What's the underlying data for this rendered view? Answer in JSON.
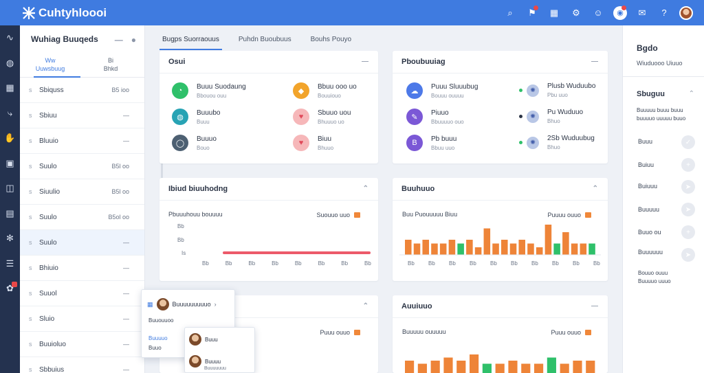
{
  "app": {
    "title": "Cuhtyhloooi"
  },
  "topbar": {
    "icons": [
      "search-icon",
      "alert-icon",
      "apps-icon",
      "settings-icon",
      "people-icon",
      "notifications-icon",
      "chat-icon",
      "help-icon",
      "user-avatar"
    ],
    "colors": {
      "bar": "#3f7be0",
      "badge": "#e94848"
    }
  },
  "rail": {
    "icons": [
      "activity-icon",
      "globe-icon",
      "grid-icon",
      "route-icon",
      "hand-icon",
      "window-icon",
      "box-icon",
      "layers-icon",
      "network-icon",
      "list-icon",
      "chat-alert-icon"
    ]
  },
  "panel2": {
    "title": "Wuhiag Buuqeds",
    "tabs": [
      {
        "top": "Ww",
        "label": "Uuwsbuug",
        "active": true
      },
      {
        "top": "Bi",
        "label": "Bhkd",
        "active": false
      }
    ],
    "rows": [
      {
        "num": "s",
        "label": "Sbiquss",
        "meta": "B5 ioo"
      },
      {
        "num": "s",
        "label": "Sbiuu",
        "meta": "—"
      },
      {
        "num": "s",
        "label": "Bluuio",
        "meta": "—"
      },
      {
        "num": "s",
        "label": "Suulo",
        "meta": "B5l oo"
      },
      {
        "num": "s",
        "label": "Siuulio",
        "meta": "B5l oo"
      },
      {
        "num": "s",
        "label": "Suulo",
        "meta": "B5ol oo"
      },
      {
        "num": "s",
        "label": "Suulo",
        "meta": "—"
      },
      {
        "num": "s",
        "label": "Bhiuio",
        "meta": "—"
      },
      {
        "num": "s",
        "label": "Suuol",
        "meta": "—"
      },
      {
        "num": "s",
        "label": "Sluio",
        "meta": "—"
      },
      {
        "num": "s",
        "label": "Buuioluo",
        "meta": "—"
      },
      {
        "num": "s",
        "label": "Sbbuius",
        "meta": "—"
      }
    ]
  },
  "main": {
    "tabs": [
      {
        "label": "Bugps Suorraouus",
        "active": true
      },
      {
        "label": "Puhdn Buoubuus",
        "active": false
      },
      {
        "label": "Bouhs Pouyo",
        "active": false
      }
    ],
    "card1": {
      "title": "Osui",
      "services": [
        {
          "title": "Buuu Suodaung",
          "sub": "Bbouou ouu",
          "color": "#2fc06a",
          "icon": "cloud-icon"
        },
        {
          "title": "Bbuu ooo uo",
          "sub": "Bouuiouo",
          "color": "#f2a42b",
          "icon": "server-icon"
        },
        {
          "title": "Buuubo",
          "sub": "Buuu",
          "color": "#27a3b4",
          "icon": "globe-icon"
        },
        {
          "title": "Sbuuo uou",
          "sub": "Bhuuuo uo",
          "color": "#f6b7b9",
          "icon": "heart-icon"
        },
        {
          "title": "Buuuo",
          "sub": "Bouo",
          "color": "#4d6072",
          "icon": "ring-icon"
        },
        {
          "title": "Biuu",
          "sub": "Bhuuo",
          "color": "#f6b7b9",
          "icon": "heart-icon"
        }
      ]
    },
    "card2": {
      "title": "Pboubuuiag",
      "services": [
        {
          "title": "Puuu Sluuubug",
          "sub": "Bouuu ouuuu",
          "color": "#4d79e8",
          "icon": "cloud-icon"
        },
        {
          "title": "Piuuo",
          "sub": "Bbuuuuo ouo",
          "color": "#7b58d6",
          "icon": "pencil-icon"
        },
        {
          "title": "Pb buuu",
          "sub": "Bbuu uuo",
          "color": "#7b58d6",
          "icon": "bitcoin-icon"
        },
        {
          "title": "Plusb Wuduubo",
          "sub": "Pbu uuo",
          "color": "#b9c7e6",
          "icon": "satellite-icon"
        },
        {
          "title": "Pu Wuduuo",
          "sub": "Bhuo",
          "color": "#b9c7e6",
          "icon": "satellite-icon"
        },
        {
          "title": "2Sb Wuduubug",
          "sub": "Bhuo",
          "color": "#b9c7e6",
          "icon": "satellite-icon"
        }
      ]
    },
    "card3": {
      "title": "Ibiud biuuhodng",
      "subtitle": "Pbuuuhouu bouuuu",
      "legend": "Suouuo uuo",
      "ylabels": [
        "Bb",
        "Bb",
        "Is"
      ],
      "xlabels": [
        "Bb",
        "Bb",
        "Bb",
        "Bb",
        "Bb",
        "Bb",
        "Bb",
        "Bb"
      ]
    },
    "card4": {
      "title": "Buuhuuo",
      "subtitle": "Buu Puouuuuu Biuu",
      "legend": "Puuuu ouuo"
    },
    "card5": {
      "title": ""
    },
    "card6": {
      "title": "Auuiuuo",
      "subtitle": "Buuuuu ouuuuu",
      "legend": "Puuu ouuo"
    }
  },
  "chart_data": [
    {
      "type": "line",
      "title": "Ibiud biuuhodng",
      "series": [
        {
          "name": "Suouuo uuo",
          "values": [
            1,
            1,
            1,
            1,
            1,
            1,
            1,
            1,
            1,
            1
          ]
        }
      ]
    },
    {
      "type": "bar",
      "title": "Buuhuuo",
      "categories": [
        "Bb",
        "Bb",
        "Bb",
        "Bb",
        "Bb",
        "Bb",
        "Bb",
        "Bb",
        "Bb",
        "Bb",
        "Bb",
        "Bb",
        "Bb",
        "Bb",
        "Bb",
        "Bb",
        "Bb",
        "Bb",
        "Bb",
        "Bb"
      ],
      "series": [
        {
          "name": "Puuuu ouuo",
          "values": [
            4,
            3,
            4,
            3,
            3,
            4,
            3,
            4,
            2,
            7,
            3,
            4,
            3,
            4,
            3,
            2,
            8,
            3,
            6,
            3,
            3,
            3
          ]
        }
      ],
      "highlight_indices": [
        6,
        17,
        21
      ],
      "colors": {
        "bar": "#ee8438",
        "highlight": "#2fc06a"
      }
    },
    {
      "type": "bar",
      "title": "Auuiuuo",
      "series": [
        {
          "name": "Puuu ouuo",
          "values": [
            4,
            3,
            4,
            5,
            4,
            6,
            3,
            3,
            4,
            3,
            3,
            5,
            3,
            4,
            4
          ]
        }
      ],
      "highlight_indices": [
        6,
        11
      ],
      "colors": {
        "bar": "#ee8438",
        "highlight": "#2fc06a"
      }
    }
  ],
  "rpanel": {
    "title": "Bgdo",
    "sub": "Wiuduooo Uiuuo",
    "h2": "Sbuguu",
    "desc": "Buuuuu buuu buuu buuuuo uuuuu buuo",
    "items": [
      "Buuu",
      "Buiuu",
      "Buiuuu",
      "Buuuuu",
      "Buuo ou",
      "Buuuuuu"
    ],
    "foot1": "Bouuo ouuu",
    "foot2": "Buuuuo uuuo"
  },
  "popup": {
    "name": "Buuuuuuuuuo",
    "line1": "Buuouuoo",
    "line2": "Buuuuo",
    "line3": "Buuo",
    "sub1": "Buuu",
    "sub2": "Buuuu",
    "sub3": "Buuuuuuu"
  }
}
